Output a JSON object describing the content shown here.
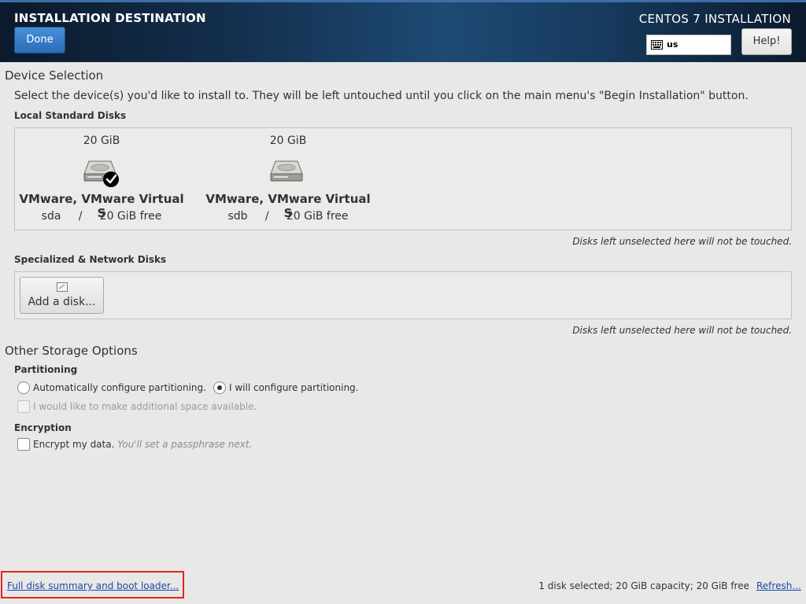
{
  "header": {
    "title": "INSTALLATION DESTINATION",
    "done_label": "Done",
    "product": "CENTOS 7 INSTALLATION",
    "keyboard_layout": "us",
    "help_label": "Help!"
  },
  "device_selection": {
    "title": "Device Selection",
    "description": "Select the device(s) you'd like to install to.  They will be left untouched until you click on the main menu's \"Begin Installation\" button.",
    "local_title": "Local Standard Disks",
    "disks": [
      {
        "size": "20 GiB",
        "name": "VMware, VMware Virtual S",
        "device": "sda",
        "sep": "/",
        "free": "20 GiB free",
        "selected": true
      },
      {
        "size": "20 GiB",
        "name": "VMware, VMware Virtual S",
        "device": "sdb",
        "sep": "/",
        "free": "20 GiB free",
        "selected": false
      }
    ],
    "local_note": "Disks left unselected here will not be touched.",
    "special_title": "Specialized & Network Disks",
    "add_disk_label": "Add a disk...",
    "special_note": "Disks left unselected here will not be touched."
  },
  "other_storage": {
    "title": "Other Storage Options",
    "partitioning_title": "Partitioning",
    "auto_label": "Automatically configure partitioning.",
    "manual_label": "I will configure partitioning.",
    "partitioning_selected": "manual",
    "space_label": "I would like to make additional space available.",
    "encryption_title": "Encryption",
    "encrypt_label": "Encrypt my data.",
    "encrypt_hint": "You'll set a passphrase next."
  },
  "footer": {
    "summary_link": "Full disk summary and boot loader...",
    "status": "1 disk selected; 20 GiB capacity; 20 GiB free",
    "refresh_link": "Refresh..."
  }
}
